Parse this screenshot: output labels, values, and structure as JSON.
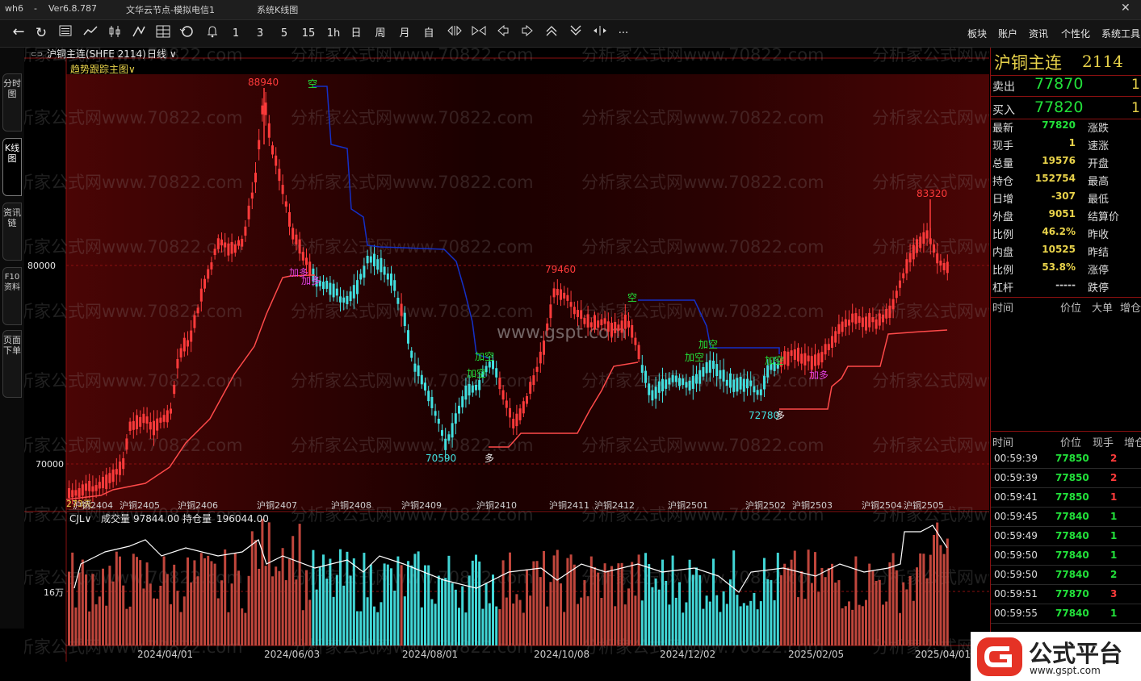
{
  "window": {
    "app": "wh6",
    "sep": "-",
    "version": "Ver6.8.787",
    "server": "文华云节点-模拟电信1",
    "line_tool": "系统K线图"
  },
  "toolbar": {
    "numbers": [
      "1",
      "3",
      "5",
      "15",
      "1h",
      "日",
      "周",
      "月",
      "自"
    ],
    "more": "···",
    "right_menu": [
      "板块",
      "账户",
      "资讯",
      "个性化",
      "系统工具"
    ]
  },
  "left_tabs": [
    "分时图",
    "K线图",
    "资讯链",
    "F10资料",
    "页面下单"
  ],
  "chart_header": {
    "symbol": "沪铜主连(SHFE 2114)",
    "period": "日线",
    "indicator": "趋势跟踪主图"
  },
  "watermarks": {
    "repeat": "分析家公式网www.70822.com",
    "center": "www.gspt.com"
  },
  "price_axis": {
    "label_80000": "80000",
    "label_70000": "70000"
  },
  "annotations": {
    "high1": "88940",
    "low1": "70590",
    "high2": "79460",
    "low2": "72780",
    "high3": "83320",
    "kong": "空",
    "jiakong": "加空",
    "jiaduo": "加多",
    "duo": "多",
    "days": "273天"
  },
  "contract_labels": [
    "沪铜2404",
    "沪铜2405",
    "沪铜2406",
    "沪铜2407",
    "沪铜2408",
    "沪铜2409",
    "沪铜2410",
    "沪铜2411",
    "沪铜2412",
    "沪铜2501",
    "沪铜2502",
    "沪铜2503",
    "沪铜2504",
    "沪铜2505"
  ],
  "volume_header": {
    "name": "CJL",
    "vol_label": "成交量",
    "vol_value": "97844.00",
    "oi_label": "持仓量",
    "oi_value": "196044.00",
    "axis_label": "16万"
  },
  "dates": [
    "2024/04/01",
    "2024/06/03",
    "2024/08/01",
    "2024/10/08",
    "2024/12/02",
    "2025/02/05",
    "2025/04/01"
  ],
  "quote": {
    "name": "沪铜主连",
    "code": "2114",
    "sell_label": "卖出",
    "sell_price": "77870",
    "sell_qty": "1",
    "buy_label": "买入",
    "buy_price": "77820",
    "buy_qty": "1",
    "rows": [
      {
        "label": "最新",
        "value": "77820",
        "label2": "涨跌",
        "color": "#22e03a"
      },
      {
        "label": "现手",
        "value": "1",
        "label2": "速涨",
        "color": "#e8d24a"
      },
      {
        "label": "总量",
        "value": "19576",
        "label2": "开盘",
        "color": "#e8d24a"
      },
      {
        "label": "持仓",
        "value": "152754",
        "label2": "最高",
        "color": "#e8d24a"
      },
      {
        "label": "日增",
        "value": "-307",
        "label2": "最低",
        "color": "#e8d24a"
      },
      {
        "label": "外盘",
        "value": "9051",
        "label2": "结算价",
        "color": "#e8d24a"
      },
      {
        "label": "比例",
        "value": "46.2%",
        "label2": "昨收",
        "color": "#e8d24a"
      },
      {
        "label": "内盘",
        "value": "10525",
        "label2": "昨结",
        "color": "#e8d24a"
      },
      {
        "label": "比例",
        "value": "53.8%",
        "label2": "涨停",
        "color": "#e8d24a"
      },
      {
        "label": "杠杆",
        "value": "-----",
        "label2": "跌停",
        "color": "#cccccc"
      }
    ],
    "big_header": {
      "time": "时间",
      "price": "价位",
      "big": "大单",
      "add": "增仓"
    },
    "tick_header": {
      "time": "时间",
      "price": "价位",
      "qty": "现手",
      "add": "增仓"
    },
    "ticks": [
      {
        "time": "00:59:39",
        "price": "77850",
        "qty": "2"
      },
      {
        "time": "00:59:39",
        "price": "77850",
        "qty": "2"
      },
      {
        "time": "00:59:41",
        "price": "77850",
        "qty": "1"
      },
      {
        "time": "00:59:45",
        "price": "77840",
        "qty": "1"
      },
      {
        "time": "00:59:49",
        "price": "77840",
        "qty": "1"
      },
      {
        "time": "00:59:50",
        "price": "77840",
        "qty": "1"
      },
      {
        "time": "00:59:50",
        "price": "77840",
        "qty": "2"
      },
      {
        "time": "00:59:51",
        "price": "77870",
        "qty": "3"
      },
      {
        "time": "00:59:55",
        "price": "77840",
        "qty": "1"
      }
    ],
    "tick_qty_colors": [
      "#ff3b3b",
      "#ff3b3b",
      "#ff3b3b",
      "#22e03a",
      "#22e03a",
      "#22e03a",
      "#22e03a",
      "#ff3b3b",
      "#22e03a"
    ]
  },
  "badge": {
    "title": "公式平台",
    "url": "www.gspt.com"
  },
  "colors": {
    "up": "#ff3b3b",
    "down": "#41e0e0",
    "trend_short": "#1430c8",
    "trend_long": "#ff4a4a",
    "price_green": "#22e03a",
    "highlight_yellow": "#e8d24a",
    "signal_green": "#22e03a",
    "signal_magenta": "#e040e0"
  }
}
